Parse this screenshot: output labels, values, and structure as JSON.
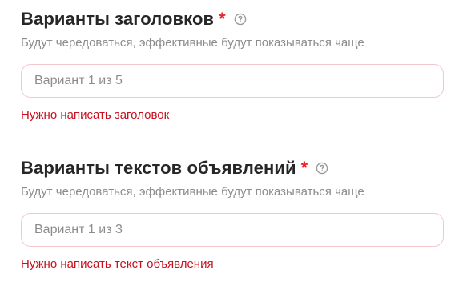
{
  "colors": {
    "required": "#e5242c",
    "error": "#c8101d",
    "border_error": "#f4c7ce",
    "hint": "#8c8c8c"
  },
  "headlines": {
    "title": "Варианты заголовков",
    "required_mark": "*",
    "help_icon": "question-circle-icon",
    "hint": "Будут чередоваться, эффективные будут показываться чаще",
    "input_placeholder": "Вариант 1 из 5",
    "input_value": "",
    "error": "Нужно написать заголовок"
  },
  "texts": {
    "title": "Варианты текстов объявлений",
    "required_mark": "*",
    "help_icon": "question-circle-icon",
    "hint": "Будут чередоваться, эффективные будут показываться чаще",
    "input_placeholder": "Вариант 1 из 3",
    "input_value": "",
    "error": "Нужно написать текст объявления"
  }
}
